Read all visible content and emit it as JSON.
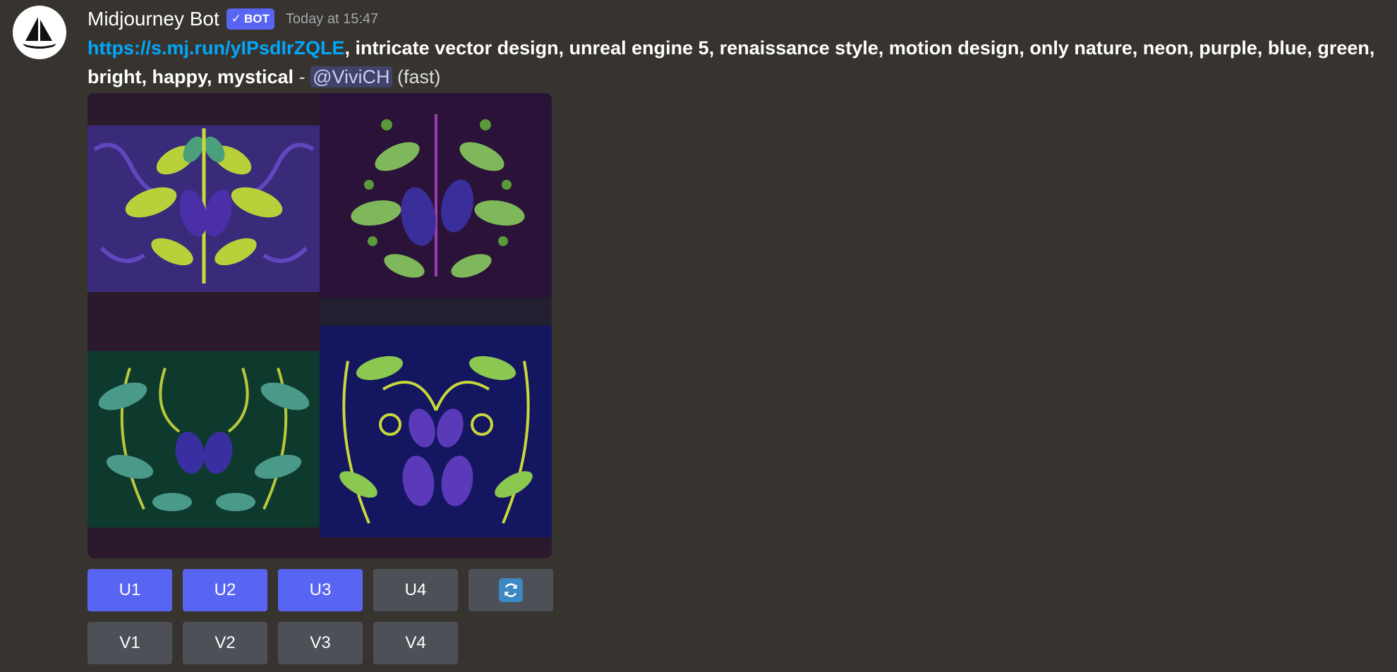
{
  "author": {
    "name": "Midjourney Bot",
    "badge": "BOT",
    "timestamp": "Today at 15:47"
  },
  "message": {
    "link": "https://s.mj.run/yIPsdIrZQLE",
    "prompt": ", intricate vector design, unreal engine 5, renaissance style, motion design, only nature, neon, purple, blue, green, bright, happy, mystical",
    "separator": " - ",
    "mention": "@ViviCH",
    "speed": " (fast)"
  },
  "images": [
    {
      "icon": "plant-artwork-1"
    },
    {
      "icon": "plant-artwork-2"
    },
    {
      "icon": "plant-artwork-3"
    },
    {
      "icon": "plant-artwork-4"
    }
  ],
  "buttons": {
    "upscale": [
      {
        "label": "U1",
        "style": "primary"
      },
      {
        "label": "U2",
        "style": "primary"
      },
      {
        "label": "U3",
        "style": "primary"
      },
      {
        "label": "U4",
        "style": "secondary"
      }
    ],
    "reroll_icon": "refresh-icon",
    "variation": [
      {
        "label": "V1"
      },
      {
        "label": "V2"
      },
      {
        "label": "V3"
      },
      {
        "label": "V4"
      }
    ]
  },
  "colors": {
    "background": "#37342f",
    "accent": "#5865f2",
    "secondary_button": "#4e5058",
    "link": "#00a8fc",
    "refresh_icon_bg": "#3b88c3"
  }
}
